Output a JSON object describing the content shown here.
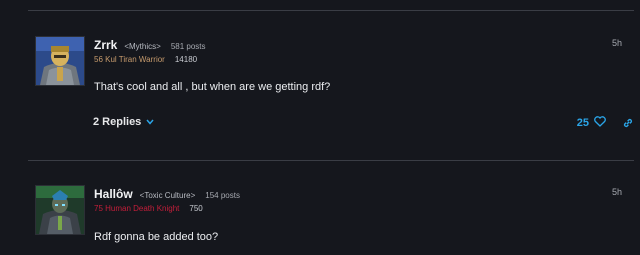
{
  "posts": [
    {
      "author": "Zrrk",
      "guild": "<Mythics>",
      "post_count": "581 posts",
      "character": "56 Kul Tiran Warrior",
      "achievement_points": "14180",
      "time": "5h",
      "body": "That's cool and all , but when are we getting rdf?",
      "replies_label": "2 Replies",
      "likes": "25",
      "class_color": "#c69b6d",
      "avatar_icon": "armored-warrior-avatar"
    },
    {
      "author": "Hallôw",
      "guild": "<Toxic Culture>",
      "post_count": "154 posts",
      "character": "75 Human Death Knight",
      "achievement_points": "750",
      "time": "5h",
      "body": "Rdf gonna be added too?",
      "class_color": "#c41e3a",
      "avatar_icon": "death-knight-avatar"
    }
  ],
  "icons": {
    "replies_toggle": "chevron-down-icon",
    "like": "heart-icon",
    "share": "link-icon"
  },
  "colors": {
    "accent": "#2aa5e8",
    "background": "#15171d"
  }
}
